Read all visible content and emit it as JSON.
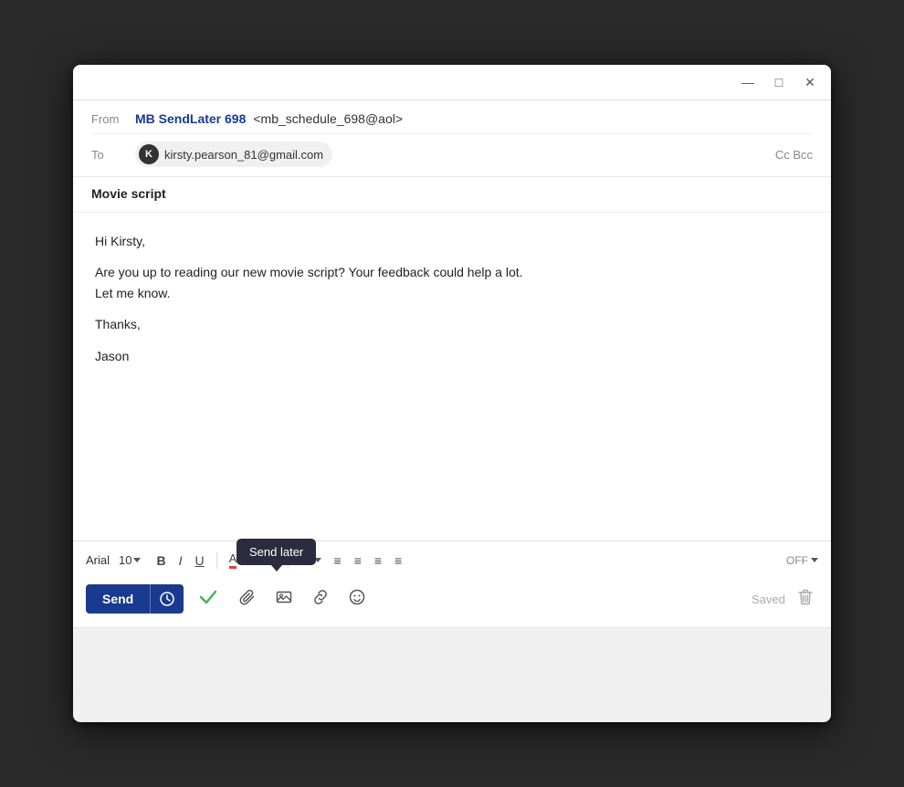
{
  "window": {
    "title_bar": {
      "minimize_label": "—",
      "maximize_label": "□",
      "close_label": "✕"
    }
  },
  "email": {
    "from_label": "From",
    "from_name": "MB SendLater 698",
    "from_email": "<mb_schedule_698@aol>",
    "to_label": "To",
    "recipient_initial": "K",
    "recipient_email": "kirsty.pearson_81@gmail.com",
    "cc_bcc_label": "Cc Bcc",
    "subject": "Movie script",
    "body_line1": "Hi Kirsty,",
    "body_line2": "Are you up to reading our new movie script? Your feedback could help a lot.",
    "body_line3": "Let me know.",
    "body_line4": "Thanks,",
    "body_line5": "Jason"
  },
  "toolbar": {
    "font_name": "Arial",
    "font_size": "10",
    "bold_label": "B",
    "italic_label": "I",
    "underline_label": "U",
    "off_label": "OFF",
    "saved_label": "Saved"
  },
  "actions": {
    "send_label": "Send",
    "send_later_tooltip": "Send later"
  }
}
